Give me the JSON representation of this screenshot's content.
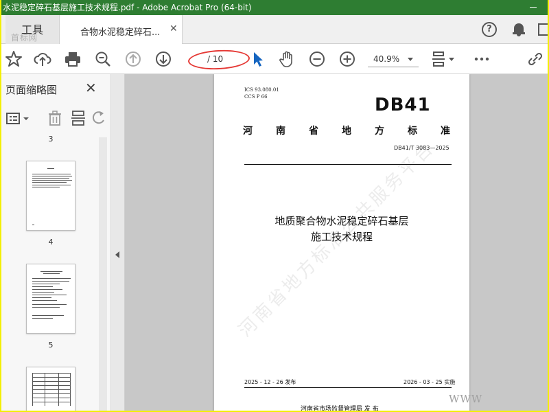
{
  "window": {
    "title": "水泥稳定碎石基层施工技术规程.pdf - Adobe Acrobat Pro (64-bit)"
  },
  "tabs": {
    "tools_label": "工具",
    "document_label": "合物水泥稳定碎石...",
    "corner_watermark": "首标网"
  },
  "toolbar": {
    "page_current": "",
    "page_total": "/ 10",
    "zoom_value": "40.9%"
  },
  "left_panel": {
    "title": "页面缩略图",
    "thumbnails": [
      {
        "label": "3"
      },
      {
        "label": "4"
      },
      {
        "label": "5"
      }
    ]
  },
  "document": {
    "ics": "ICS 93.080.01",
    "ccs": "CCS P 66",
    "logo": "DB41",
    "standard_type_chars": [
      "河",
      "南",
      "省",
      "地",
      "方",
      "标",
      "准"
    ],
    "standard_number": "DB41/T 3083—2025",
    "title_line1": "地质聚合物水泥稳定碎石基层",
    "title_line2": "施工技术规程",
    "watermark": "河南省地方标准公共服务平台",
    "issue_date": "2025 - 12 - 26 发布",
    "implement_date": "2026 - 03 - 25 实施",
    "issuer": "河南省市场监督管理局    发 布"
  },
  "www_mark": "WWW",
  "colors": {
    "titlebar": "#2e7d32",
    "frame_border": "#f3ef00",
    "annotation": "#e53935",
    "pointer_cursor": "#1565c0"
  }
}
